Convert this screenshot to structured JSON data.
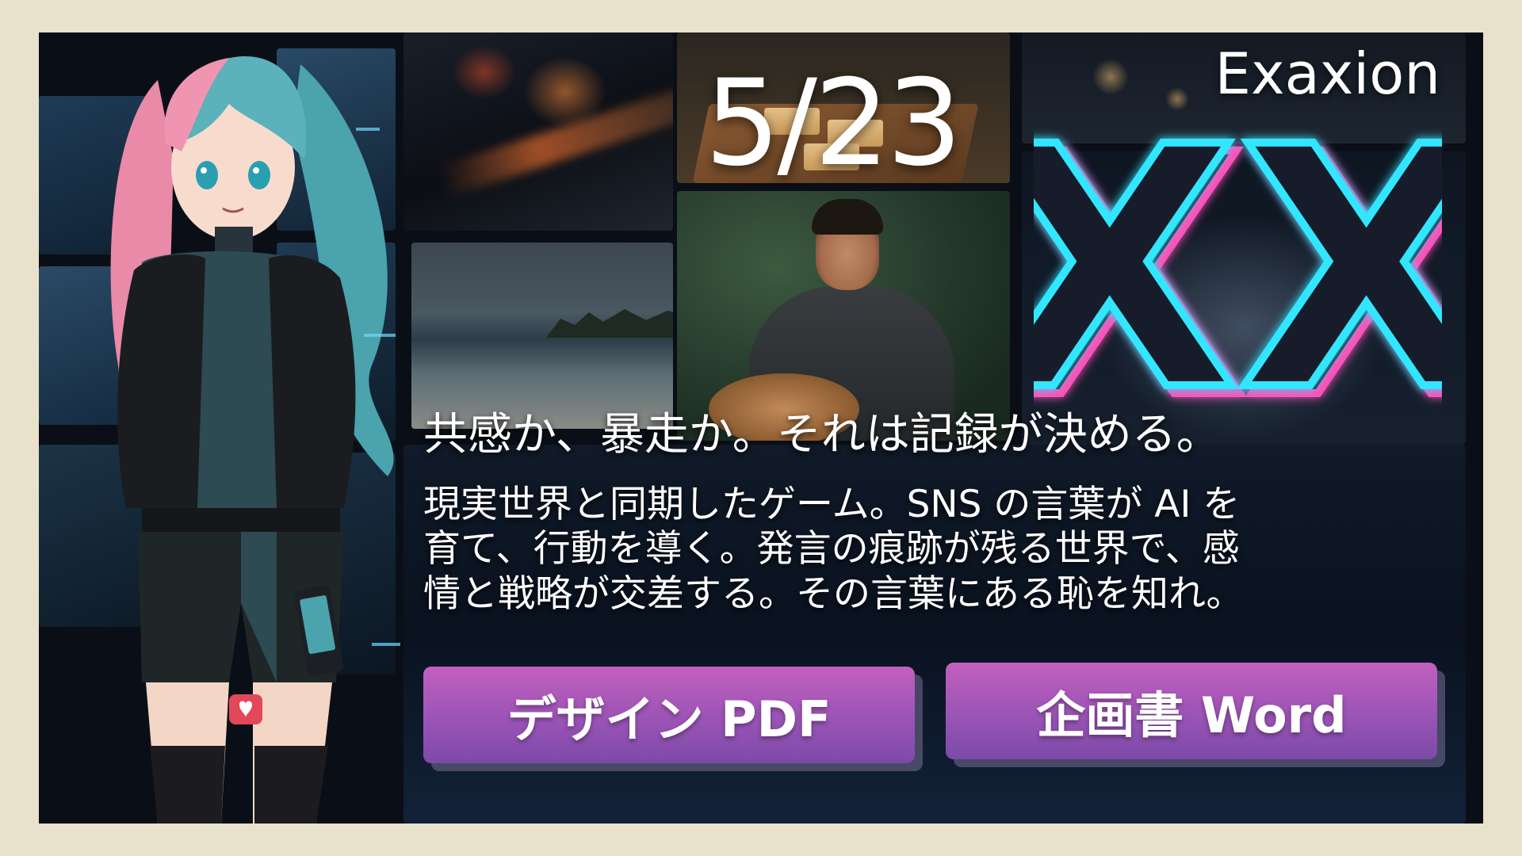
{
  "event": {
    "date": "5/23",
    "brand": "Exaxion",
    "logo_text": "XX"
  },
  "content": {
    "tagline": "共感か、暴走か。それは記録が決める。",
    "description_lines": [
      "現実世界と同期したゲーム。SNS の言葉が AI を",
      "育て、行動を導く。発言の痕跡が残る世界で、感",
      "情と戦略が交差する。その言葉にある恥を知れ。"
    ]
  },
  "buttons": {
    "design_pdf": "デザイン PDF",
    "proposal_word": "企画書 Word"
  },
  "colors": {
    "page_background": "#e8e1cc",
    "button_top": "#c35fbe",
    "button_bottom": "#7d4aa8",
    "logo_cyan": "#33e6ff",
    "logo_pink": "#ff4fb8"
  }
}
